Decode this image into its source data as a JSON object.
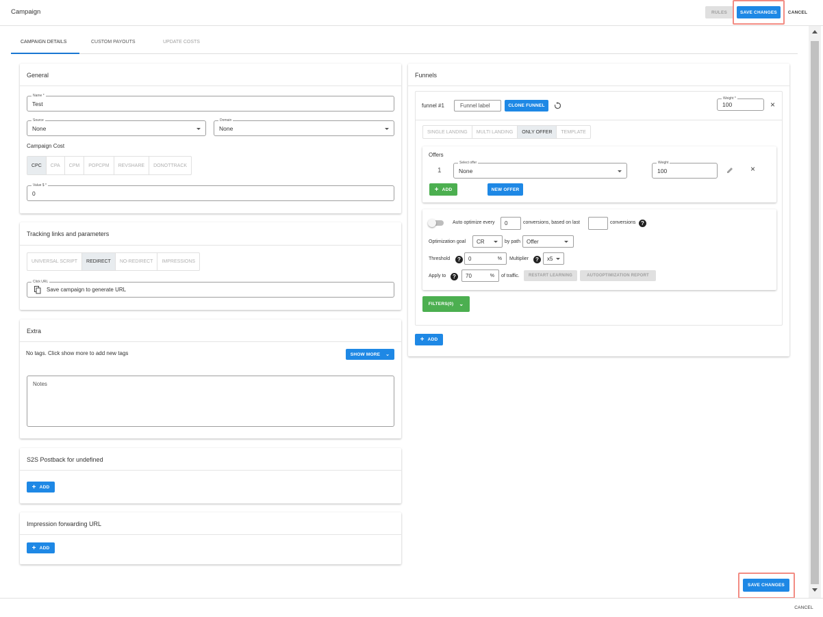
{
  "header": {
    "title": "Campaign",
    "rules_label": "RULES",
    "save_label": "SAVE CHANGES",
    "cancel_label": "CANCEL"
  },
  "tabs": [
    {
      "label": "CAMPAIGN DETAILS"
    },
    {
      "label": "CUSTOM PAYOUTS"
    },
    {
      "label": "UPDATE COSTS"
    }
  ],
  "general": {
    "title": "General",
    "name_label": "Name *",
    "name_value": "Test",
    "source_label": "Source",
    "source_value": "None",
    "domain_label": "Domain",
    "domain_value": "None",
    "cost_title": "Campaign Cost",
    "cost_models": [
      "CPC",
      "CPA",
      "CPM",
      "POPCPM",
      "REVSHARE",
      "DONOTTRACK"
    ],
    "value_label": "Value $ *",
    "value_value": "0"
  },
  "tracking": {
    "title": "Tracking links and parameters",
    "modes": [
      "UNIVERSAL SCRIPT",
      "REDIRECT",
      "NO-REDIRECT",
      "IMPRESSIONS"
    ],
    "click_url_label": "Click URL",
    "click_url_value": "Save campaign to generate URL"
  },
  "extra": {
    "title": "Extra",
    "no_tags": "No tags. Click show more to add new tags",
    "show_more_label": "SHOW MORE",
    "notes_placeholder": "Notes"
  },
  "s2s": {
    "title": "S2S Postback for undefined",
    "add_label": "ADD"
  },
  "impression": {
    "title": "Impression forwarding URL",
    "add_label": "ADD"
  },
  "funnels": {
    "title": "Funnels",
    "funnel_name": "funnel #1",
    "funnel_label_placeholder": "Funnel label",
    "clone_label": "CLONE FUNNEL",
    "weight_label": "Weight *",
    "weight_value": "100",
    "types": [
      "SINGLE LANDING",
      "MULTI LANDING",
      "ONLY OFFER",
      "TEMPLATE"
    ],
    "offers_title": "Offers",
    "offer_index": "1",
    "select_offer_label": "Select offer",
    "select_offer_value": "None",
    "offer_weight_label": "Weight",
    "offer_weight_value": "100",
    "add_label": "ADD",
    "new_offer_label": "NEW OFFER",
    "auto_optimize_text": "Auto optimize every",
    "auto_every_value": "0",
    "conversions_based_text": "conversions, based on last",
    "conversions_last_value": "",
    "conversions_text": "conversions",
    "goal_label": "Optimization goal",
    "goal_value": "CR",
    "by_path_label": "by path",
    "path_value": "Offer",
    "threshold_label": "Threshold",
    "threshold_value": "0",
    "percent": "%",
    "multiplier_label": "Multiplier",
    "multiplier_value": "x5",
    "apply_label": "Apply to",
    "apply_value": "70",
    "traffic_text": "of traffic.",
    "restart_label": "RESTART LEARNING",
    "report_label": "AUTOOPTIMIZATION REPORT",
    "filters_label": "FILTERS(0)",
    "add_funnel_label": "ADD"
  },
  "footer": {
    "save_label": "SAVE CHANGES",
    "cancel_label": "CANCEL"
  },
  "colors": {
    "accent": "#1e88e5",
    "green": "#4caf50",
    "highlight": "#f28b82"
  }
}
